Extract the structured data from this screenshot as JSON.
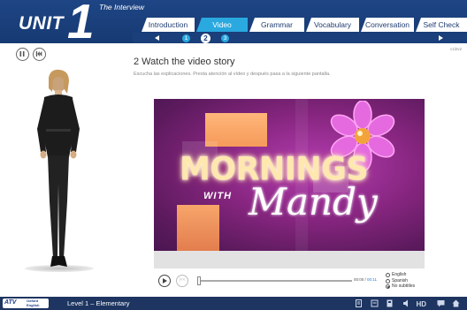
{
  "header": {
    "unit_word": "UNIT",
    "unit_number": "1",
    "section_title": "The Interview",
    "tabs": [
      {
        "label": "Introduction",
        "active": false
      },
      {
        "label": "Video",
        "active": true
      },
      {
        "label": "Grammar",
        "active": false
      },
      {
        "label": "Vocabulary",
        "active": false
      },
      {
        "label": "Conversation",
        "active": false
      },
      {
        "label": "Self Check",
        "active": false
      }
    ],
    "pages": [
      "1",
      "2",
      "3"
    ],
    "current_page": "2"
  },
  "page_code": "c1l2v2",
  "step": {
    "title": "2  Watch the video story",
    "instructions": "Escucha las explicaciones. Presta atención al vídeo y después pasa a la siguiente pantalla."
  },
  "video": {
    "title_line1": "MORNINGS",
    "title_with": "WITH",
    "title_line2": "Mandy"
  },
  "player": {
    "rewind_label": "|<<",
    "time_elapsed": "00:00",
    "time_separator": " / ",
    "time_total": "00:11",
    "subtitle_options": [
      "English",
      "Spanish",
      "No subtitles"
    ],
    "selected_subtitle": "No subtitles"
  },
  "footer": {
    "logo_left": "ATV",
    "logo_right_1": "Oxford",
    "logo_right_2": "English",
    "level": "Level 1 – Elementary"
  },
  "colors": {
    "header_bg": "#1e4585",
    "tab_active": "#2aa9e0",
    "footer_bg": "#1d3560",
    "video_bg": "#86257f"
  }
}
